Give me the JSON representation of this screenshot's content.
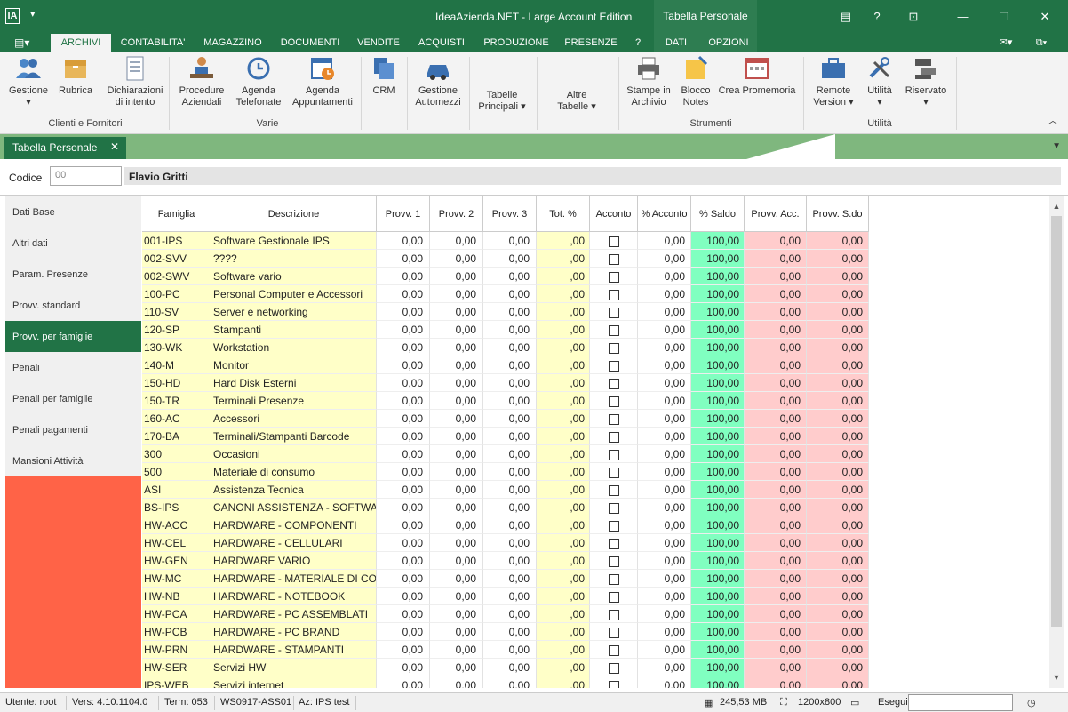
{
  "window": {
    "app_icon": "IA",
    "title": "IdeaAzienda.NET - Large Account Edition",
    "context_tab_title": "Tabella Personale",
    "help": "?",
    "icons": [
      "document-icon",
      "help-icon",
      "restore-icon",
      "minimize-icon",
      "maximize-icon",
      "close-icon"
    ]
  },
  "ribbon_tabs": {
    "items": [
      {
        "label": "ARCHIVI",
        "active": true
      },
      {
        "label": "CONTABILITA'"
      },
      {
        "label": "MAGAZZINO"
      },
      {
        "label": "DOCUMENTI"
      },
      {
        "label": "VENDITE"
      },
      {
        "label": "ACQUISTI"
      },
      {
        "label": "PRODUZIONE"
      },
      {
        "label": "PRESENZE"
      },
      {
        "label": "?"
      },
      {
        "label": "DATI"
      },
      {
        "label": "OPZIONI"
      }
    ]
  },
  "ribbon": {
    "buttons": [
      {
        "label1": "Gestione",
        "label2": "▾",
        "icon": "users-icon"
      },
      {
        "label1": "Rubrica",
        "label2": "",
        "icon": "box-icon"
      },
      {
        "label1": "Dichiarazioni",
        "label2": "di intento",
        "icon": "document-icon"
      },
      {
        "label1": "Procedure",
        "label2": "Aziendali",
        "icon": "person-desk-icon"
      },
      {
        "label1": "Agenda",
        "label2": "Telefonate",
        "icon": "history-icon"
      },
      {
        "label1": "Agenda",
        "label2": "Appuntamenti",
        "icon": "calendar-clock-icon"
      },
      {
        "label1": "CRM",
        "label2": "",
        "icon": "crm-icon"
      },
      {
        "label1": "Gestione",
        "label2": "Automezzi",
        "icon": "car-icon"
      },
      {
        "label1": "Tabelle",
        "label2": "Principali ▾",
        "icon": ""
      },
      {
        "label1": "Altre",
        "label2": "Tabelle ▾",
        "icon": ""
      },
      {
        "label1": "Stampe in",
        "label2": "Archivio",
        "icon": "printer-icon"
      },
      {
        "label1": "Blocco",
        "label2": "Notes",
        "icon": "sticky-note-icon"
      },
      {
        "label1": "Crea Promemoria",
        "label2": "",
        "icon": "calendar-icon"
      },
      {
        "label1": "Remote",
        "label2": "Version ▾",
        "icon": "briefcase-icon"
      },
      {
        "label1": "Utilità",
        "label2": "▾",
        "icon": "tools-icon"
      },
      {
        "label1": "Riservato",
        "label2": "▾",
        "icon": "server-icon"
      }
    ],
    "groups": [
      "Clienti e Fornitori",
      "Varie",
      "Strumenti",
      "Utilità"
    ]
  },
  "doc_tab": {
    "label": "Tabella Personale",
    "close": "✕"
  },
  "form": {
    "codice_label": "Codice",
    "codice_value": "00",
    "name": "Flavio Gritti"
  },
  "left_nav": [
    {
      "label": "Dati Base"
    },
    {
      "label": "Altri dati"
    },
    {
      "label": "Param. Presenze"
    },
    {
      "label": "Provv. standard"
    },
    {
      "label": "Provv. per famiglie",
      "selected": true
    },
    {
      "label": "Penali"
    },
    {
      "label": "Penali per famiglie"
    },
    {
      "label": "Penali pagamenti"
    },
    {
      "label": "Mansioni Attività"
    }
  ],
  "grid": {
    "columns": [
      "Famiglia",
      "Descrizione",
      "Provv. 1",
      "Provv. 2",
      "Provv. 3",
      "Tot. %",
      "Acconto",
      "% Acconto",
      "% Saldo",
      "Provv. Acc.",
      "Provv. S.do"
    ],
    "rows": [
      {
        "fam": "001-IPS",
        "desc": "Software Gestionale IPS",
        "p1": "0,00",
        "p2": "0,00",
        "p3": "0,00",
        "tot": ",00",
        "pacc": "0,00",
        "sal": "100,00",
        "pa": "0,00",
        "ps": "0,00"
      },
      {
        "fam": "002-SVV",
        "desc": "????",
        "p1": "0,00",
        "p2": "0,00",
        "p3": "0,00",
        "tot": ",00",
        "pacc": "0,00",
        "sal": "100,00",
        "pa": "0,00",
        "ps": "0,00"
      },
      {
        "fam": "002-SWV",
        "desc": "Software vario",
        "p1": "0,00",
        "p2": "0,00",
        "p3": "0,00",
        "tot": ",00",
        "pacc": "0,00",
        "sal": "100,00",
        "pa": "0,00",
        "ps": "0,00"
      },
      {
        "fam": "100-PC",
        "desc": "Personal Computer e Accessori",
        "p1": "0,00",
        "p2": "0,00",
        "p3": "0,00",
        "tot": ",00",
        "pacc": "0,00",
        "sal": "100,00",
        "pa": "0,00",
        "ps": "0,00"
      },
      {
        "fam": "110-SV",
        "desc": "Server e networking",
        "p1": "0,00",
        "p2": "0,00",
        "p3": "0,00",
        "tot": ",00",
        "pacc": "0,00",
        "sal": "100,00",
        "pa": "0,00",
        "ps": "0,00"
      },
      {
        "fam": "120-SP",
        "desc": "Stampanti",
        "p1": "0,00",
        "p2": "0,00",
        "p3": "0,00",
        "tot": ",00",
        "pacc": "0,00",
        "sal": "100,00",
        "pa": "0,00",
        "ps": "0,00"
      },
      {
        "fam": "130-WK",
        "desc": "Workstation",
        "p1": "0,00",
        "p2": "0,00",
        "p3": "0,00",
        "tot": ",00",
        "pacc": "0,00",
        "sal": "100,00",
        "pa": "0,00",
        "ps": "0,00"
      },
      {
        "fam": "140-M",
        "desc": "Monitor",
        "p1": "0,00",
        "p2": "0,00",
        "p3": "0,00",
        "tot": ",00",
        "pacc": "0,00",
        "sal": "100,00",
        "pa": "0,00",
        "ps": "0,00"
      },
      {
        "fam": "150-HD",
        "desc": "Hard Disk Esterni",
        "p1": "0,00",
        "p2": "0,00",
        "p3": "0,00",
        "tot": ",00",
        "pacc": "0,00",
        "sal": "100,00",
        "pa": "0,00",
        "ps": "0,00"
      },
      {
        "fam": "150-TR",
        "desc": "Terminali Presenze",
        "p1": "0,00",
        "p2": "0,00",
        "p3": "0,00",
        "tot": ",00",
        "pacc": "0,00",
        "sal": "100,00",
        "pa": "0,00",
        "ps": "0,00"
      },
      {
        "fam": "160-AC",
        "desc": "Accessori",
        "p1": "0,00",
        "p2": "0,00",
        "p3": "0,00",
        "tot": ",00",
        "pacc": "0,00",
        "sal": "100,00",
        "pa": "0,00",
        "ps": "0,00"
      },
      {
        "fam": "170-BA",
        "desc": "Terminali/Stampanti Barcode",
        "p1": "0,00",
        "p2": "0,00",
        "p3": "0,00",
        "tot": ",00",
        "pacc": "0,00",
        "sal": "100,00",
        "pa": "0,00",
        "ps": "0,00"
      },
      {
        "fam": "300",
        "desc": "Occasioni",
        "p1": "0,00",
        "p2": "0,00",
        "p3": "0,00",
        "tot": ",00",
        "pacc": "0,00",
        "sal": "100,00",
        "pa": "0,00",
        "ps": "0,00"
      },
      {
        "fam": "500",
        "desc": "Materiale di consumo",
        "p1": "0,00",
        "p2": "0,00",
        "p3": "0,00",
        "tot": ",00",
        "pacc": "0,00",
        "sal": "100,00",
        "pa": "0,00",
        "ps": "0,00"
      },
      {
        "fam": "ASI",
        "desc": "Assistenza Tecnica",
        "p1": "0,00",
        "p2": "0,00",
        "p3": "0,00",
        "tot": ",00",
        "pacc": "0,00",
        "sal": "100,00",
        "pa": "0,00",
        "ps": "0,00"
      },
      {
        "fam": "BS-IPS",
        "desc": "CANONI ASSISTENZA - SOFTWARE",
        "p1": "0,00",
        "p2": "0,00",
        "p3": "0,00",
        "tot": ",00",
        "pacc": "0,00",
        "sal": "100,00",
        "pa": "0,00",
        "ps": "0,00"
      },
      {
        "fam": "HW-ACC",
        "desc": "HARDWARE - COMPONENTI",
        "p1": "0,00",
        "p2": "0,00",
        "p3": "0,00",
        "tot": ",00",
        "pacc": "0,00",
        "sal": "100,00",
        "pa": "0,00",
        "ps": "0,00"
      },
      {
        "fam": "HW-CEL",
        "desc": "HARDWARE - CELLULARI",
        "p1": "0,00",
        "p2": "0,00",
        "p3": "0,00",
        "tot": ",00",
        "pacc": "0,00",
        "sal": "100,00",
        "pa": "0,00",
        "ps": "0,00"
      },
      {
        "fam": "HW-GEN",
        "desc": "HARDWARE VARIO",
        "p1": "0,00",
        "p2": "0,00",
        "p3": "0,00",
        "tot": ",00",
        "pacc": "0,00",
        "sal": "100,00",
        "pa": "0,00",
        "ps": "0,00"
      },
      {
        "fam": "HW-MC",
        "desc": "HARDWARE - MATERIALE DI CONSU",
        "p1": "0,00",
        "p2": "0,00",
        "p3": "0,00",
        "tot": ",00",
        "pacc": "0,00",
        "sal": "100,00",
        "pa": "0,00",
        "ps": "0,00"
      },
      {
        "fam": "HW-NB",
        "desc": "HARDWARE - NOTEBOOK",
        "p1": "0,00",
        "p2": "0,00",
        "p3": "0,00",
        "tot": ",00",
        "pacc": "0,00",
        "sal": "100,00",
        "pa": "0,00",
        "ps": "0,00"
      },
      {
        "fam": "HW-PCA",
        "desc": "HARDWARE - PC ASSEMBLATI",
        "p1": "0,00",
        "p2": "0,00",
        "p3": "0,00",
        "tot": ",00",
        "pacc": "0,00",
        "sal": "100,00",
        "pa": "0,00",
        "ps": "0,00"
      },
      {
        "fam": "HW-PCB",
        "desc": "HARDWARE - PC BRAND",
        "p1": "0,00",
        "p2": "0,00",
        "p3": "0,00",
        "tot": ",00",
        "pacc": "0,00",
        "sal": "100,00",
        "pa": "0,00",
        "ps": "0,00"
      },
      {
        "fam": "HW-PRN",
        "desc": "HARDWARE - STAMPANTI",
        "p1": "0,00",
        "p2": "0,00",
        "p3": "0,00",
        "tot": ",00",
        "pacc": "0,00",
        "sal": "100,00",
        "pa": "0,00",
        "ps": "0,00"
      },
      {
        "fam": "HW-SER",
        "desc": "Servizi HW",
        "p1": "0,00",
        "p2": "0,00",
        "p3": "0,00",
        "tot": ",00",
        "pacc": "0,00",
        "sal": "100,00",
        "pa": "0,00",
        "ps": "0,00"
      },
      {
        "fam": "IPS-WEB",
        "desc": "Servizi internet",
        "p1": "0,00",
        "p2": "0,00",
        "p3": "0,00",
        "tot": ",00",
        "pacc": "0,00",
        "sal": "100,00",
        "pa": "0,00",
        "ps": "0,00"
      }
    ]
  },
  "status": {
    "user": "Utente: root",
    "version": "Vers: 4.10.1104.0",
    "term": "Term: 053",
    "ws": "WS0917-ASS01",
    "az": "Az: IPS test",
    "memory": "245,53 MB",
    "resolution": "1200x800",
    "esegui": "Esegui",
    "esegui_value": ""
  },
  "colors": {
    "accent": "#217346",
    "left_nav_bg": "#ff6347",
    "yellow_cells": "#ffffc8",
    "saldo_green": "#80ffc0",
    "provv_red": "#ffcccc"
  }
}
